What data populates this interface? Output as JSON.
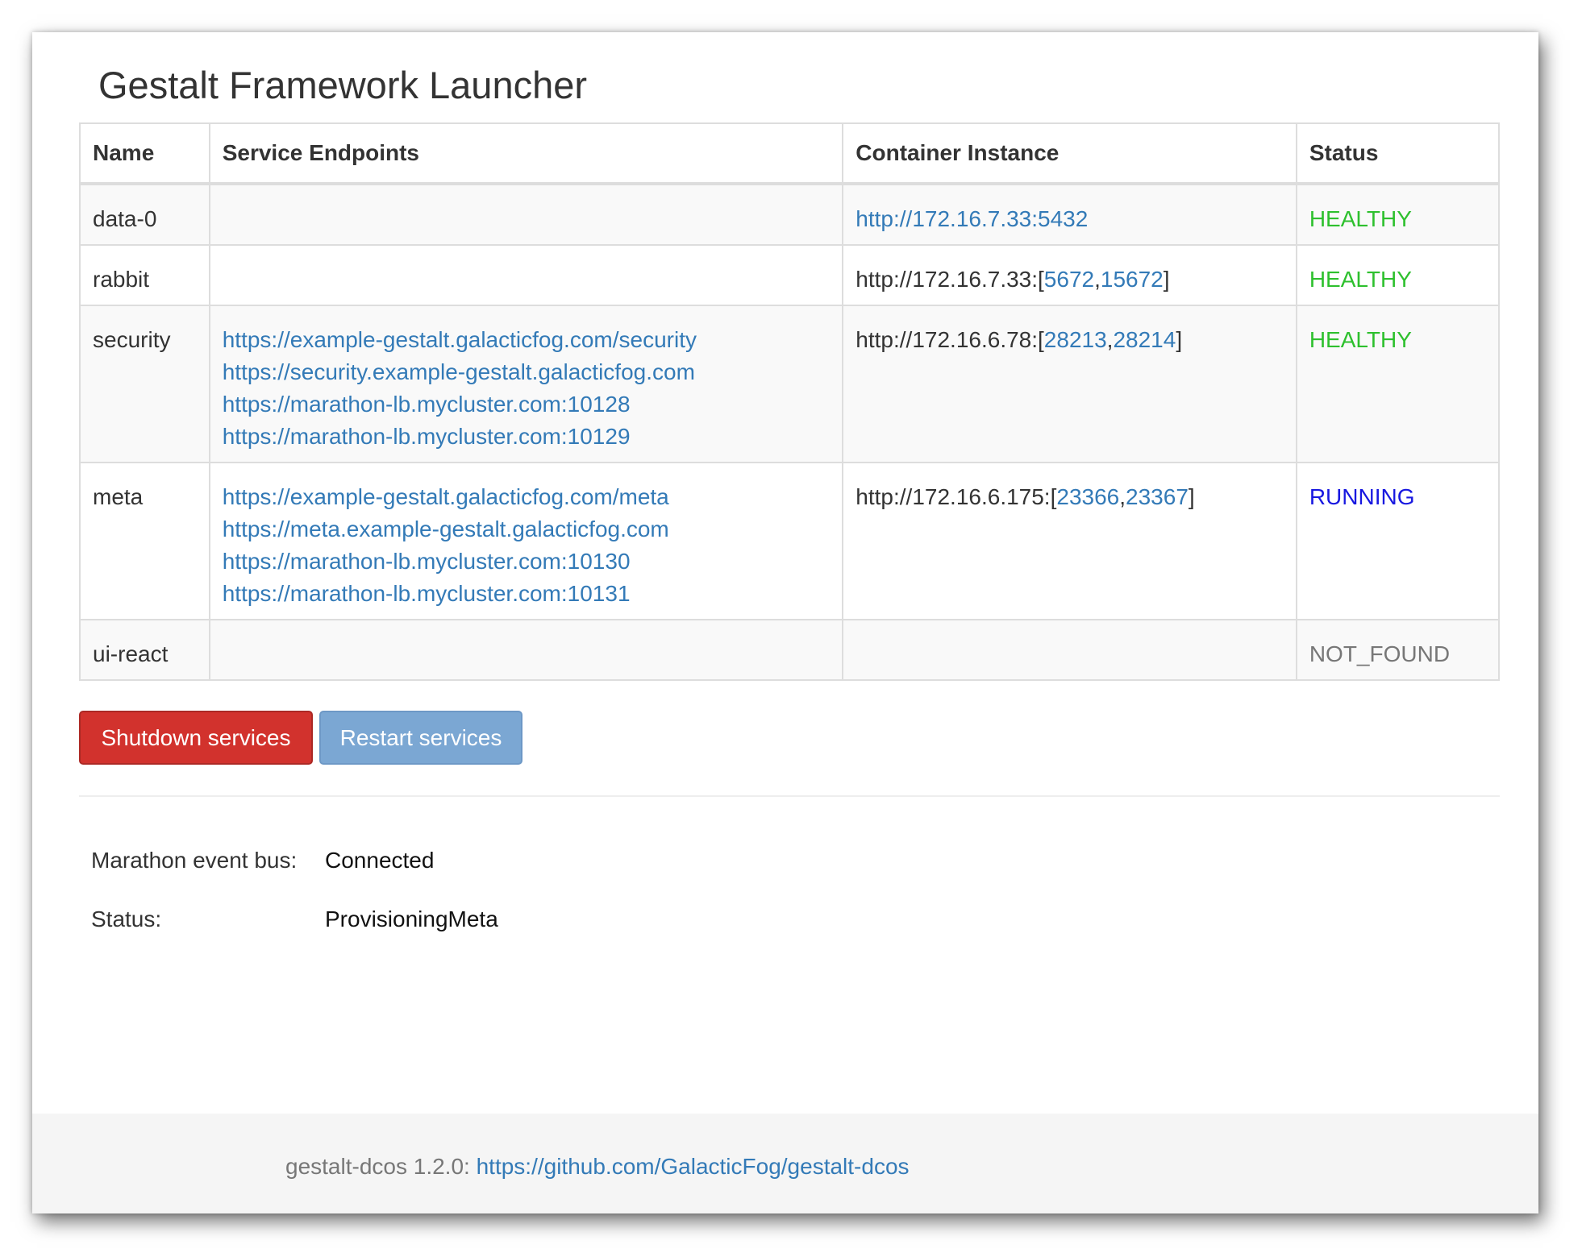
{
  "page": {
    "title": "Gestalt Framework Launcher"
  },
  "table": {
    "headers": [
      "Name",
      "Service Endpoints",
      "Container Instance",
      "Status"
    ],
    "rows": [
      {
        "name": "data-0",
        "endpoints": [],
        "container": "http://172.16.7.33:5432",
        "status": "HEALTHY"
      },
      {
        "name": "rabbit",
        "endpoints": [],
        "container_prefix": "http://172.16.7.33:[",
        "ports": [
          "5672",
          "15672"
        ],
        "container_suffix": "]",
        "status": "HEALTHY"
      },
      {
        "name": "security",
        "endpoints": [
          "https://example-gestalt.galacticfog.com/security",
          "https://security.example-gestalt.galacticfog.com",
          "https://marathon-lb.mycluster.com:10128",
          "https://marathon-lb.mycluster.com:10129"
        ],
        "container_prefix": "http://172.16.6.78:[",
        "ports": [
          "28213",
          "28214"
        ],
        "container_suffix": "]",
        "status": "HEALTHY"
      },
      {
        "name": "meta",
        "endpoints": [
          "https://example-gestalt.galacticfog.com/meta",
          "https://meta.example-gestalt.galacticfog.com",
          "https://marathon-lb.mycluster.com:10130",
          "https://marathon-lb.mycluster.com:10131"
        ],
        "container_prefix": "http://172.16.6.175:[",
        "ports": [
          "23366",
          "23367"
        ],
        "container_suffix": "]",
        "status": "RUNNING"
      },
      {
        "name": "ui-react",
        "endpoints": [],
        "container": "",
        "status": "NOT_FOUND"
      }
    ],
    "comma": ","
  },
  "actions": {
    "shutdown_label": "Shutdown services",
    "restart_label": "Restart services"
  },
  "info": {
    "event_bus_label": "Marathon event bus:",
    "event_bus_value": "Connected",
    "status_label": "Status:",
    "status_value": "ProvisioningMeta"
  },
  "footer": {
    "version_text": "gestalt-dcos 1.2.0:",
    "repo_link": "https://github.com/GalacticFog/gestalt-dcos"
  },
  "colors": {
    "healthy": "#2ec02e",
    "running": "#1818e0",
    "not_found": "#777777",
    "link": "#337ab7",
    "danger_button": "#d2322d",
    "primary_button_disabled": "#7ba7d3"
  }
}
